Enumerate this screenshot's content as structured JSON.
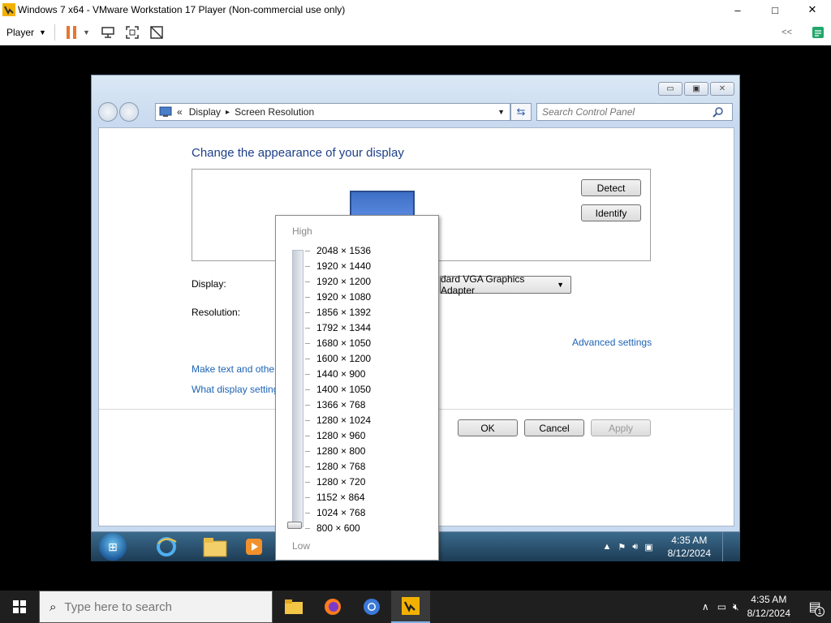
{
  "vm": {
    "title": "Windows 7 x64 - VMware Workstation 17 Player (Non-commercial use only)",
    "player_label": "Player",
    "minimize": "–",
    "maximize": "□",
    "close": "✕",
    "collapse": "<<"
  },
  "cp": {
    "breadcrumb_prefix": "«",
    "breadcrumb_1": "Display",
    "breadcrumb_sep": "▸",
    "breadcrumb_2": "Screen Resolution",
    "search_placeholder": "Search Control Panel",
    "heading": "Change the appearance of your display",
    "detect_label": "Detect",
    "identify_label": "Identify",
    "display_label": "Display:",
    "display_value": "dard VGA Graphics Adapter",
    "resolution_label": "Resolution:",
    "advanced_link": "Advanced settings",
    "link_text_size": "Make text and other",
    "link_display_settings": "What display setting",
    "ok_label": "OK",
    "cancel_label": "Cancel",
    "apply_label": "Apply"
  },
  "resolution_popup": {
    "high_label": "High",
    "low_label": "Low",
    "selected": "800 × 600",
    "options": [
      "2048 × 1536",
      "1920 × 1440",
      "1920 × 1200",
      "1920 × 1080",
      "1856 × 1392",
      "1792 × 1344",
      "1680 × 1050",
      "1600 × 1200",
      "1440 × 900",
      "1400 × 1050",
      "1366 × 768",
      "1280 × 1024",
      "1280 × 960",
      "1280 × 800",
      "1280 × 768",
      "1280 × 720",
      "1152 × 864",
      "1024 × 768",
      "800 × 600"
    ]
  },
  "guest_taskbar": {
    "time": "4:35 AM",
    "date": "8/12/2024"
  },
  "host_taskbar": {
    "search_placeholder": "Type here to search",
    "time": "4:35 AM",
    "date": "8/12/2024",
    "notification_count": "1"
  },
  "colors": {
    "link": "#1d63b5",
    "heading": "#1e3f8a",
    "vm_pause": "#e8772e"
  }
}
